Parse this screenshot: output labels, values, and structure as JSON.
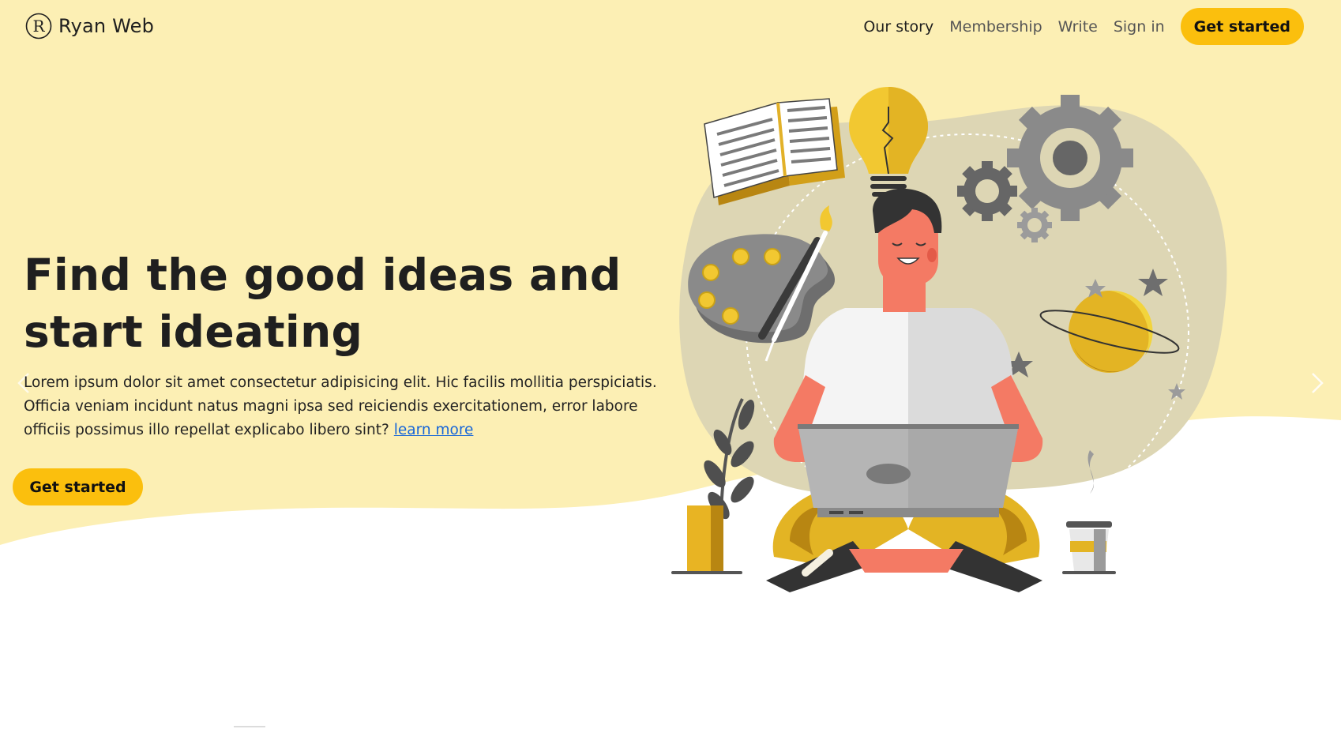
{
  "brand": {
    "logo_letter": "R",
    "name": "Ryan Web"
  },
  "nav": {
    "items": [
      {
        "label": "Our story"
      },
      {
        "label": "Membership"
      },
      {
        "label": "Write"
      },
      {
        "label": "Sign in"
      }
    ],
    "cta_label": "Get started"
  },
  "hero": {
    "title": "Find the good ideas and start ideating",
    "body": "Lorem ipsum dolor sit amet consectetur adipisicing elit. Hic facilis mollitia perspiciatis. Officia veniam incidunt natus magni ipsa sed reiciendis exercitationem, error labore officiis possimus illo repellat explicabo libero sint?",
    "learn_more_label": "learn more",
    "cta_label": "Get started"
  },
  "colors": {
    "hero_background": "#fcefb4",
    "accent": "#fbbf0d",
    "link": "#1565d8",
    "text": "#1f1f1f"
  },
  "icons": {
    "logo": "circled-r-logo-icon",
    "carousel_prev": "chevron-left-icon",
    "carousel_next": "chevron-right-icon"
  }
}
